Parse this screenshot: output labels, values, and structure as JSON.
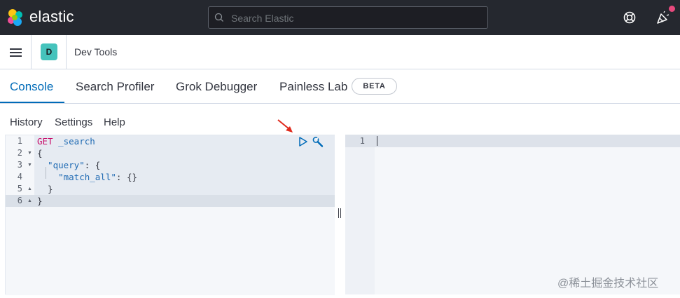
{
  "header": {
    "logo_text": "elastic",
    "search_placeholder": "Search Elastic"
  },
  "subheader": {
    "avatar_letter": "D",
    "breadcrumb": "Dev Tools"
  },
  "tabs": [
    {
      "label": "Console",
      "active": true
    },
    {
      "label": "Search Profiler",
      "active": false
    },
    {
      "label": "Grok Debugger",
      "active": false
    },
    {
      "label": "Painless Lab",
      "active": false,
      "badge": "BETA"
    }
  ],
  "console_nav": [
    "History",
    "Settings",
    "Help"
  ],
  "editor": {
    "line_numbers": [
      "1",
      "2",
      "3",
      "4",
      "5",
      "6"
    ],
    "lines": {
      "l1_method": "GET",
      "l1_path": " _search",
      "l2": "{",
      "l3_key": "  \"query\"",
      "l3_rest": ": {",
      "l4_key": "    \"match_all\"",
      "l4_rest": ": {}",
      "l5": "  }",
      "l6": "}"
    }
  },
  "output": {
    "line_numbers": [
      "1"
    ]
  },
  "watermark": "@稀土掘金技术社区",
  "colors": {
    "accent": "#006bb8",
    "topbar": "#25282f",
    "avatar": "#45c3bc",
    "keyword": "#c80a68",
    "annotation_arrow": "#e02a1c"
  }
}
